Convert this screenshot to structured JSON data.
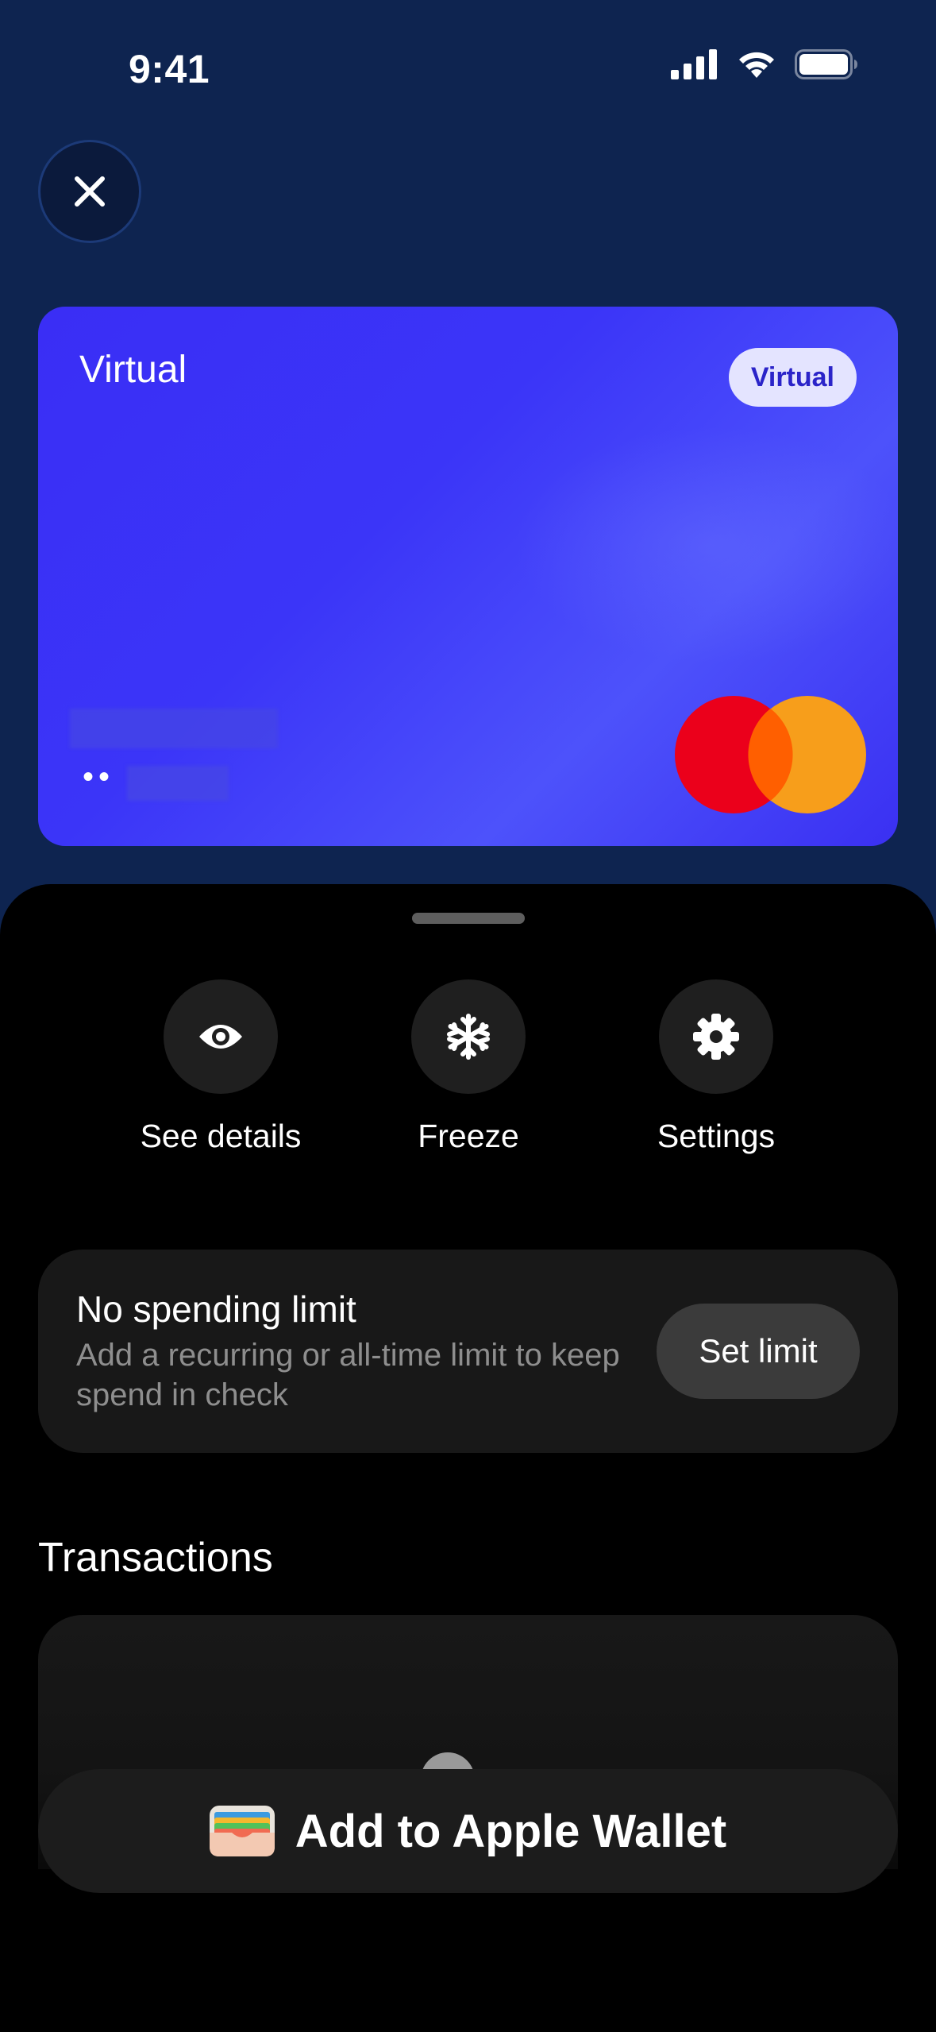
{
  "status_bar": {
    "time": "9:41"
  },
  "header": {
    "close_icon": "close-icon"
  },
  "card": {
    "title": "Virtual",
    "badge": "Virtual",
    "number_masked": "••",
    "brand_icon": "mastercard-logo",
    "colors": {
      "card_bg": "#3b35f8",
      "mc_red": "#eb001b",
      "mc_orange": "#f79e1b",
      "mc_overlap": "#ff5f00"
    }
  },
  "actions": [
    {
      "label": "See details",
      "icon": "eye-icon"
    },
    {
      "label": "Freeze",
      "icon": "snowflake-icon"
    },
    {
      "label": "Settings",
      "icon": "gear-icon"
    }
  ],
  "limit": {
    "title": "No spending limit",
    "subtitle": "Add a recurring or all-time limit to keep spend in check",
    "button": "Set limit"
  },
  "transactions": {
    "title": "Transactions"
  },
  "wallet": {
    "label": "Add to Apple Wallet",
    "icon": "apple-wallet-icon"
  }
}
